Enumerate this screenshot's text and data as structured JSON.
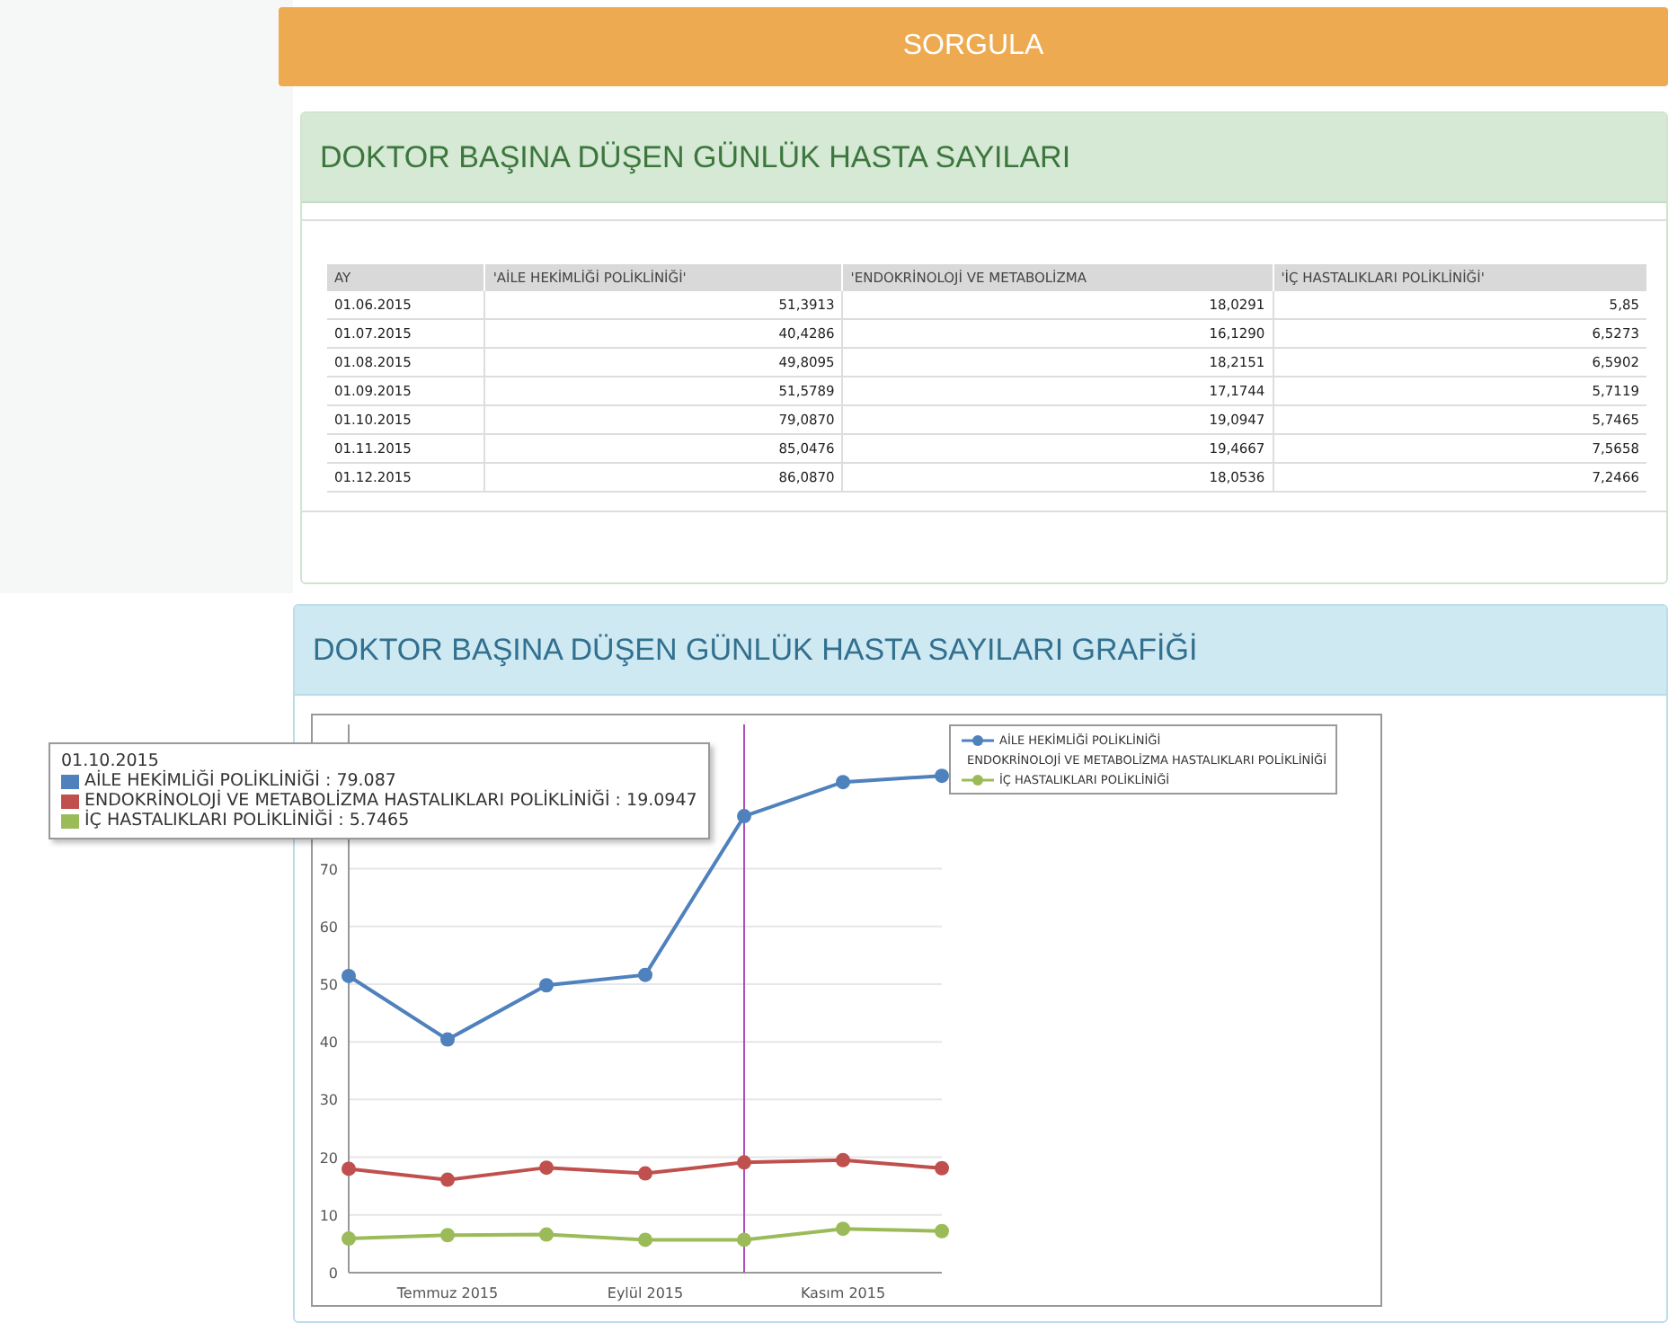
{
  "query_button": {
    "label": "SORGULA"
  },
  "table_panel": {
    "title": "DOKTOR BAŞINA DÜŞEN GÜNLÜK HASTA SAYILARI",
    "columns": [
      "AY",
      "'AİLE HEKİMLİĞİ POLİKLİNİĞİ'",
      "'ENDOKRİNOLOJİ VE METABOLİZMA",
      "'İÇ HASTALIKLARI POLİKLİNİĞİ'"
    ],
    "rows": [
      [
        "01.06.2015",
        "51,3913",
        "18,0291",
        "5,85"
      ],
      [
        "01.07.2015",
        "40,4286",
        "16,1290",
        "6,5273"
      ],
      [
        "01.08.2015",
        "49,8095",
        "18,2151",
        "6,5902"
      ],
      [
        "01.09.2015",
        "51,5789",
        "17,1744",
        "5,7119"
      ],
      [
        "01.10.2015",
        "79,0870",
        "19,0947",
        "5,7465"
      ],
      [
        "01.11.2015",
        "85,0476",
        "19,4667",
        "7,5658"
      ],
      [
        "01.12.2015",
        "86,0870",
        "18,0536",
        "7,2466"
      ]
    ]
  },
  "chart_panel": {
    "title": "DOKTOR BAŞINA DÜŞEN GÜNLÜK HASTA SAYILARI GRAFİĞİ",
    "chart_data": {
      "type": "line",
      "categories": [
        null,
        "Temmuz 2015",
        null,
        "Eylül 2015",
        null,
        "Kasım 2015",
        null
      ],
      "grid": true,
      "legend": "right",
      "yticks": [
        0,
        10,
        20,
        30,
        40,
        50,
        60,
        70
      ],
      "ylim": [
        0,
        95
      ],
      "series": [
        {
          "name": "AİLE HEKİMLİĞİ POLİKLİNİĞİ",
          "color": "#4f81bd",
          "marker": "circle",
          "values": [
            51.4,
            40.4,
            49.8,
            51.6,
            79.1,
            85.0,
            86.1
          ]
        },
        {
          "name": "ENDOKRİNOLOJİ VE METABOLİZMA HASTALIKLARI POLİKLİNİĞİ",
          "color": "#c0504d",
          "marker": "circle",
          "values": [
            18.0,
            16.1,
            18.2,
            17.2,
            19.1,
            19.5,
            18.1
          ]
        },
        {
          "name": "İÇ HASTALIKLARI POLİKLİNİĞİ",
          "color": "#9bbb59",
          "marker": "circle",
          "values": [
            5.9,
            6.5,
            6.6,
            5.7,
            5.7,
            7.6,
            7.2
          ]
        }
      ]
    },
    "tooltip": {
      "title": "01.10.2015",
      "items": [
        {
          "text": "AİLE HEKİMLİĞİ POLİKLİNİĞİ : 79.087",
          "color": "#4f81bd"
        },
        {
          "text": "ENDOKRİNOLOJİ VE METABOLİZMA HASTALIKLARI POLİKLİNİĞİ : 19.0947",
          "color": "#c0504d"
        },
        {
          "text": "İÇ HASTALIKLARI POLİKLİNİĞİ : 5.7465",
          "color": "#9bbb59"
        }
      ]
    }
  }
}
